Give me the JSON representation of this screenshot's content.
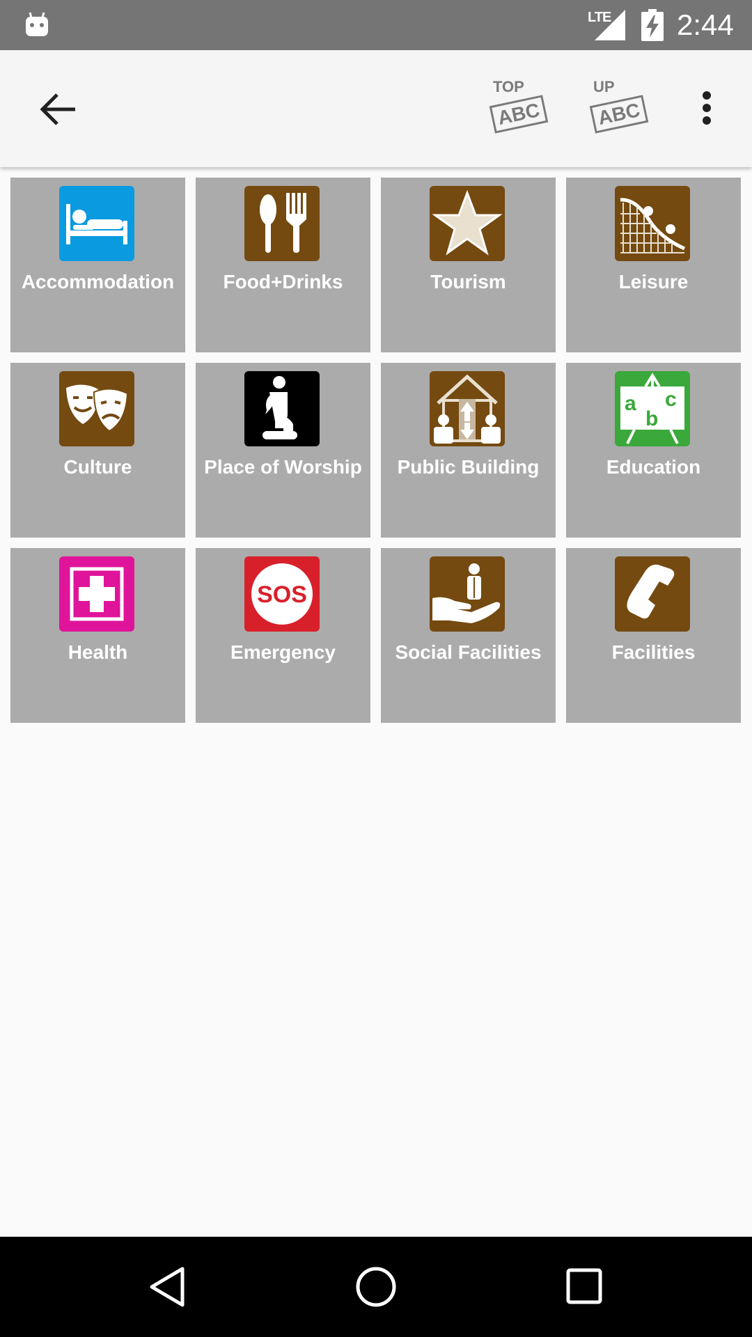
{
  "status_bar": {
    "time": "2:44",
    "network": "LTE",
    "icons": [
      "android-robot-icon",
      "lte-signal-icon",
      "battery-charging-icon"
    ]
  },
  "app_bar": {
    "back_icon": "arrow-left-icon",
    "sort_top": {
      "caption": "TOP",
      "stamp": "ABC"
    },
    "sort_up": {
      "caption": "UP",
      "stamp": "ABC"
    },
    "menu_icon": "more-vertical-icon"
  },
  "categories": [
    {
      "label": "Accommodation",
      "icon": "bed-icon",
      "color": "#0a9ae0"
    },
    {
      "label": "Food+Drinks",
      "icon": "spoon-fork-icon",
      "color": "#744a10"
    },
    {
      "label": "Tourism",
      "icon": "star-icon",
      "color": "#744a10"
    },
    {
      "label": "Leisure",
      "icon": "roller-coaster-icon",
      "color": "#744a10"
    },
    {
      "label": "Culture",
      "icon": "theater-masks-icon",
      "color": "#744a10"
    },
    {
      "label": "Place of Worship",
      "icon": "praying-person-icon",
      "color": "#000000"
    },
    {
      "label": "Public Building",
      "icon": "public-building-icon",
      "color": "#744a10"
    },
    {
      "label": "Education",
      "icon": "chalkboard-abc-icon",
      "color": "#3aa83a"
    },
    {
      "label": "Health",
      "icon": "medical-cross-icon",
      "color": "#e0149a"
    },
    {
      "label": "Emergency",
      "icon": "sos-icon",
      "color": "#d8202a"
    },
    {
      "label": "Social Facilities",
      "icon": "hand-person-icon",
      "color": "#744a10"
    },
    {
      "label": "Facilities",
      "icon": "telephone-icon",
      "color": "#744a10"
    }
  ],
  "nav_bar": {
    "icons": [
      "triangle-back-icon",
      "circle-home-icon",
      "square-recents-icon"
    ]
  }
}
